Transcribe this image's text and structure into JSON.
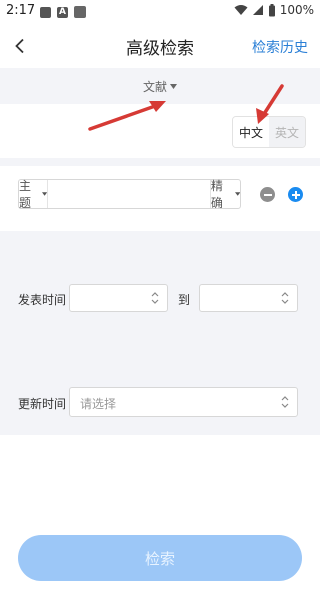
{
  "status_bar": {
    "time": "2:17",
    "battery": "100%"
  },
  "header": {
    "title": "高级检索",
    "history_label": "检索历史"
  },
  "document_type": {
    "label": "文献"
  },
  "language": {
    "options": [
      "中文",
      "英文"
    ],
    "selected": "中文"
  },
  "search_row": {
    "field_label": "主题",
    "input_value": "",
    "match_label": "精确"
  },
  "publish_time": {
    "label": "发表时间",
    "to_label": "到",
    "from_value": "",
    "to_value": ""
  },
  "update_time": {
    "label": "更新时间",
    "placeholder": "请选择"
  },
  "actions": {
    "search_label": "检索"
  },
  "colors": {
    "accent": "#2a7fd6",
    "plus_button": "#1a8bf0",
    "search_button": "#9cc7f7",
    "annotation_arrow": "#d63a35",
    "section_gray": "#f3f4f8"
  }
}
